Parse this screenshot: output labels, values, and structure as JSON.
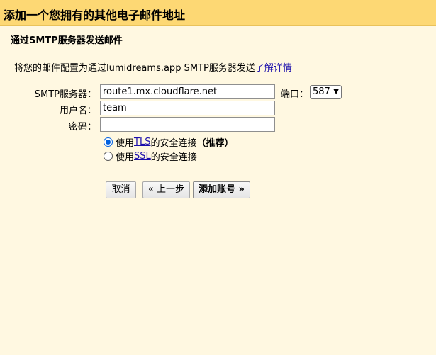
{
  "dialog": {
    "title": "添加一个您拥有的其他电子邮件地址",
    "section_title": "通过SMTP服务器发送邮件",
    "description": "将您的邮件配置为通过lumidreams.app SMTP服务器发送",
    "learn_more": "了解详情"
  },
  "form": {
    "smtp_label": "SMTP服务器：",
    "smtp_value": "route1.mx.cloudflare.net",
    "port_label": "端口：",
    "port_value": "587",
    "username_label": "用户名：",
    "username_value": "team",
    "password_label": "密码：",
    "password_value": ""
  },
  "security": {
    "tls_prefix": "使用",
    "tls_link": "TLS",
    "tls_suffix": "的安全连接",
    "tls_recommended": "（推荐）",
    "tls_checked": true,
    "ssl_prefix": "使用",
    "ssl_link": "SSL",
    "ssl_suffix": "的安全连接",
    "ssl_checked": false
  },
  "buttons": {
    "cancel": "取消",
    "back": "« 上一步",
    "add_account": "添加账号 »"
  }
}
